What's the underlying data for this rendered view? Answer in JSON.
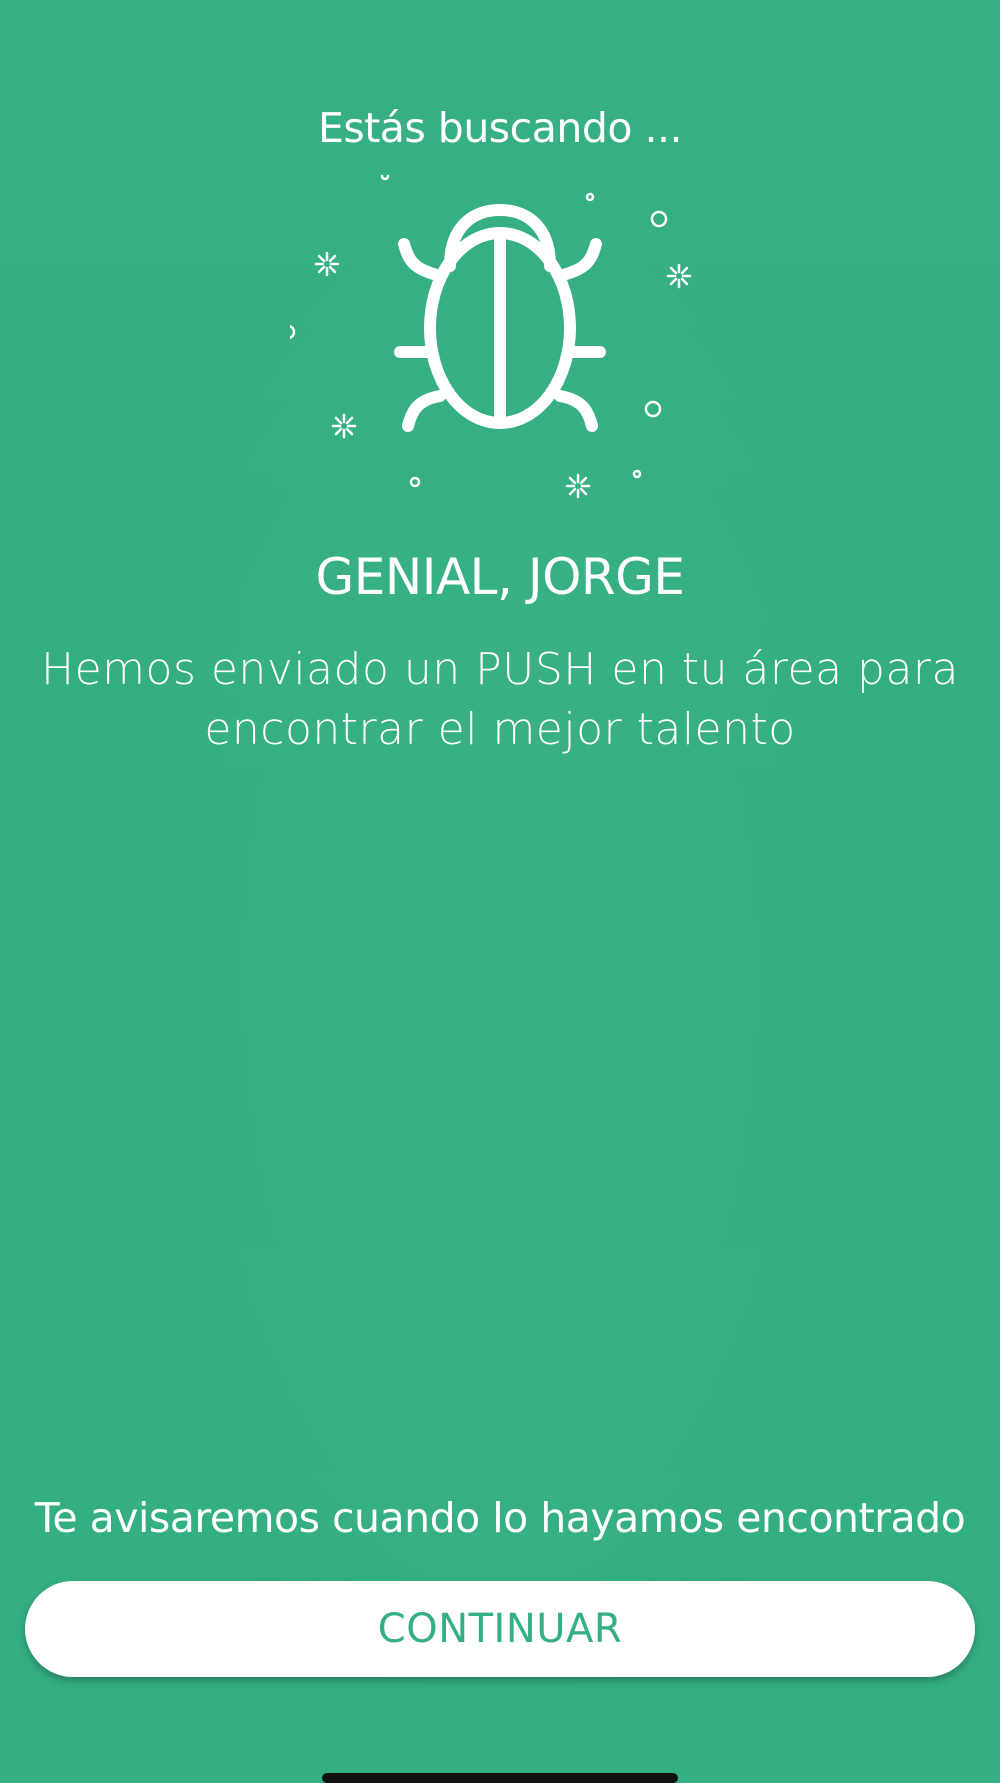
{
  "header": {
    "title": "Estás buscando ..."
  },
  "illustration": {
    "icon": "bug-icon"
  },
  "content": {
    "greeting": "GENIAL, JORGE",
    "message": "Hemos enviado un PUSH en tu área para encontrar el mejor talento"
  },
  "footer": {
    "notice": "Te avisaremos cuando lo hayamos encontrado",
    "continue_label": "CONTINUAR"
  },
  "colors": {
    "background": "#34b082",
    "accent": "#34af81",
    "button_bg": "#ffffff"
  }
}
